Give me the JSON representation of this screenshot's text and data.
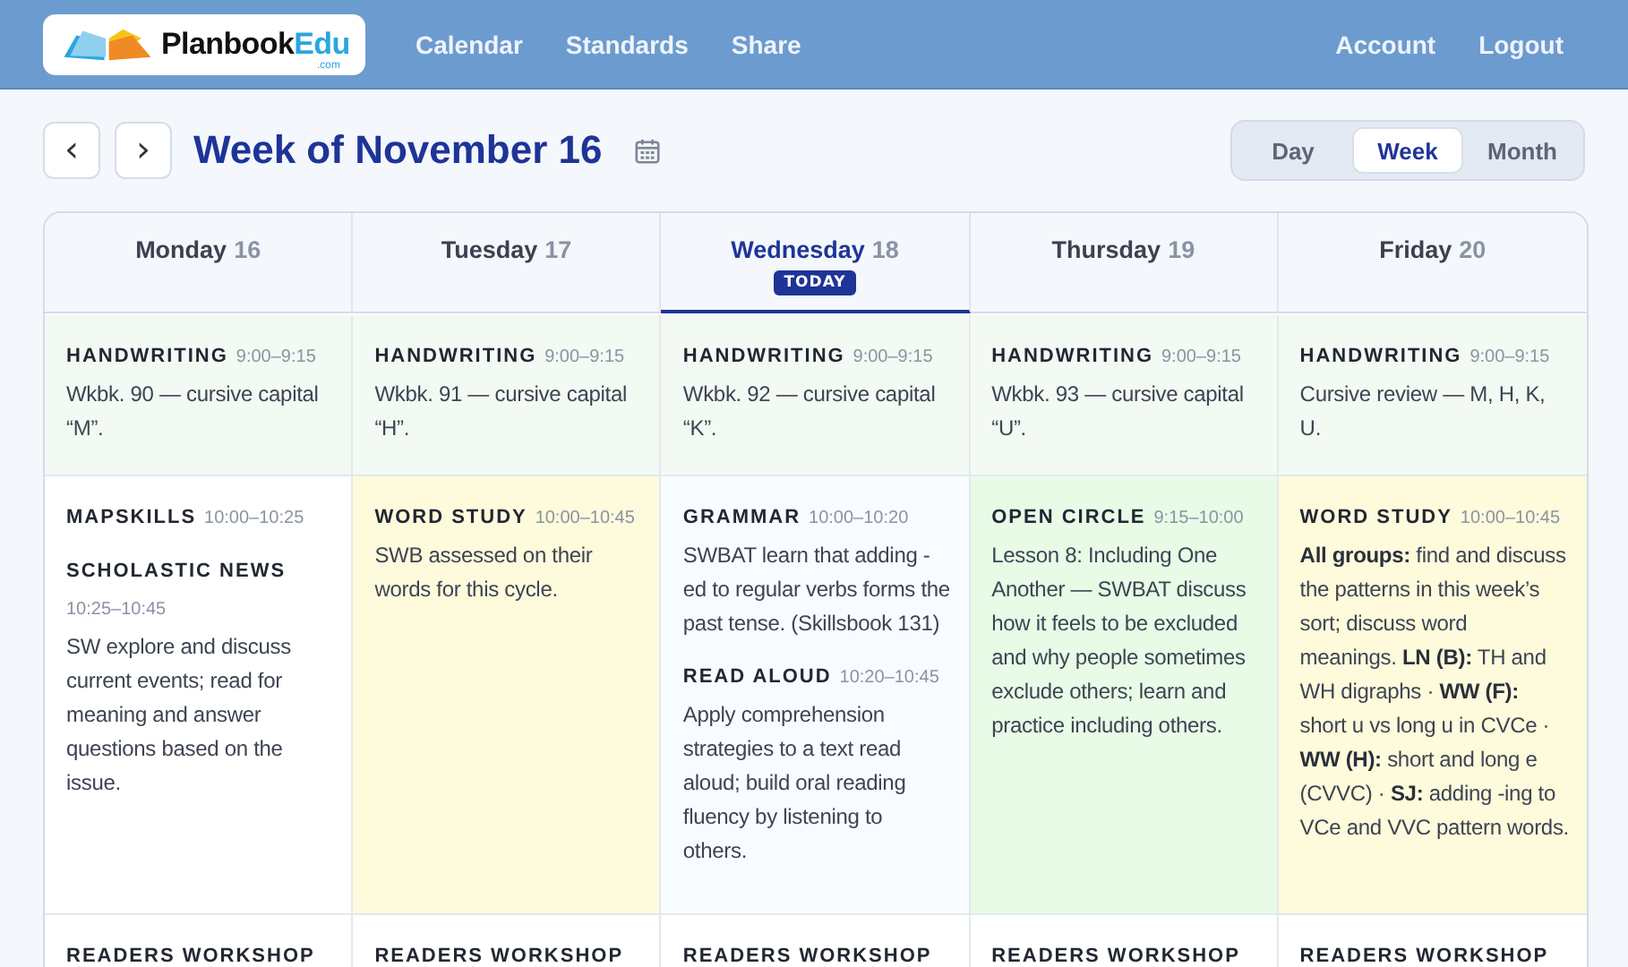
{
  "header": {
    "logo": {
      "name": "Planbook",
      "accent": "Edu",
      "suffix": ".com"
    },
    "nav": [
      {
        "label": "Calendar"
      },
      {
        "label": "Standards"
      },
      {
        "label": "Share"
      }
    ],
    "account_nav": [
      {
        "label": "Account"
      },
      {
        "label": "Logout"
      }
    ]
  },
  "toolbar": {
    "prev": "‹",
    "next": "›",
    "title": "Week of November 16",
    "views": [
      {
        "label": "Day",
        "selected": false
      },
      {
        "label": "Week",
        "selected": true
      },
      {
        "label": "Month",
        "selected": false
      }
    ]
  },
  "days": [
    {
      "name": "Monday",
      "date": "16",
      "today": false
    },
    {
      "name": "Tuesday",
      "date": "17",
      "today": false
    },
    {
      "name": "Wednesday",
      "date": "18",
      "today": true,
      "badge": "TODAY"
    },
    {
      "name": "Thursday",
      "date": "19",
      "today": false
    },
    {
      "name": "Friday",
      "date": "20",
      "today": false
    }
  ],
  "rows": [
    {
      "cells": [
        {
          "color": "#f3f9f3",
          "lessons": [
            {
              "title": "HANDWRITING",
              "time": "9:00–9:15",
              "body": "Wkbk. 90 — cursive capital “M”."
            }
          ]
        },
        {
          "color": "#f3f9f3",
          "lessons": [
            {
              "title": "HANDWRITING",
              "time": "9:00–9:15",
              "body": "Wkbk. 91 — cursive capital “H”."
            }
          ]
        },
        {
          "color": "#f3f9f3",
          "lessons": [
            {
              "title": "HANDWRITING",
              "time": "9:00–9:15",
              "body": "Wkbk. 92 — cursive capital “K”."
            }
          ]
        },
        {
          "color": "#f3f9f3",
          "lessons": [
            {
              "title": "HANDWRITING",
              "time": "9:00–9:15",
              "body": "Wkbk. 93 — cursive capital “U”."
            }
          ]
        },
        {
          "color": "#f3f9f3",
          "lessons": [
            {
              "title": "HANDWRITING",
              "time": "9:00–9:15",
              "body": "Cursive review — M, H, K, U."
            }
          ]
        }
      ]
    },
    {
      "cells": [
        {
          "color": "#ffffff",
          "lessons": [
            {
              "title": "MAPSKILLS",
              "time": "10:00–10:25"
            },
            {
              "title": "SCHOLASTIC NEWS",
              "time": "10:25–10:45",
              "body": "SW explore and discuss current events; read for meaning and answer questions based on the issue."
            }
          ]
        },
        {
          "color": "#fefadc",
          "lessons": [
            {
              "title": "WORD STUDY",
              "time": "10:00–10:45",
              "body": "SWB assessed on their words for this cycle."
            }
          ]
        },
        {
          "color": "#f8fbff",
          "lessons": [
            {
              "title": "GRAMMAR",
              "time": "10:00–10:20",
              "body": "SWBAT learn that adding -ed to regular verbs forms the past tense. (Skillsbook 131)"
            },
            {
              "title": "READ ALOUD",
              "time": "10:20–10:45",
              "body": "Apply comprehension strategies to a text read aloud; build oral reading fluency by listening to others."
            }
          ]
        },
        {
          "color": "#e8fbe7",
          "lessons": [
            {
              "title": "OPEN CIRCLE",
              "time": "9:15–10:00",
              "body": "Lesson 8: Including One Another — SWBAT discuss how it feels to be excluded and why people sometimes exclude others; learn and practice including others."
            }
          ]
        },
        {
          "color": "#fefadc",
          "lessons": [
            {
              "title": "WORD STUDY",
              "time": "10:00–10:45",
              "body": "**All groups:** find and discuss the patterns in this week’s sort; discuss word meanings. **LN (B):** TH and WH digraphs · **WW (F):** short u vs long u in CVCe · **WW (H):** short and long e (CVVC) · **SJ:** adding -ing to VCe and VVC pattern words."
            }
          ]
        }
      ]
    },
    {
      "cells": [
        {
          "color": "#ffffff",
          "lessons": [
            {
              "title": "READERS WORKSHOP"
            }
          ]
        },
        {
          "color": "#ffffff",
          "lessons": [
            {
              "title": "READERS WORKSHOP"
            }
          ]
        },
        {
          "color": "#ffffff",
          "lessons": [
            {
              "title": "READERS WORKSHOP"
            }
          ]
        },
        {
          "color": "#ffffff",
          "lessons": [
            {
              "title": "READERS WORKSHOP"
            }
          ]
        },
        {
          "color": "#ffffff",
          "lessons": [
            {
              "title": "READERS WORKSHOP"
            }
          ]
        }
      ]
    }
  ]
}
